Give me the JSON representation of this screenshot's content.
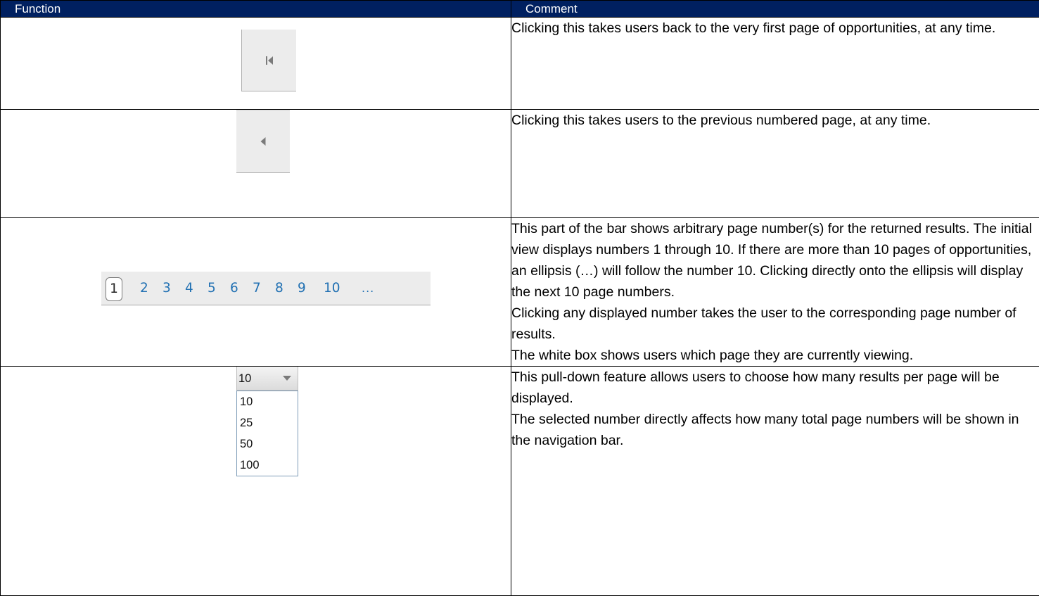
{
  "colors": {
    "header_bg": "#002060",
    "header_text": "#ffffff",
    "link_blue": "#2271b3"
  },
  "table": {
    "headers": {
      "function": "Function",
      "comment": "Comment"
    },
    "rows": [
      {
        "widget": "first-page-button",
        "icon": "first-page-icon",
        "comment": [
          "Clicking this takes users back to the very first page of opportunities, at any time."
        ]
      },
      {
        "widget": "previous-page-button",
        "icon": "previous-page-icon",
        "comment": [
          "Clicking this takes users to the previous numbered page, at any time."
        ]
      },
      {
        "widget": "page-number-bar",
        "comment": [
          "This part of the bar shows arbitrary page number(s) for the returned results. The initial view displays numbers 1 through 10. If there are more than 10 pages of opportunities, an ellipsis (…) will follow the number 10. Clicking directly onto the ellipsis will display the next 10 page numbers.",
          "Clicking any displayed number takes the user to the corresponding page number of results.",
          "The white box shows users which page they are currently viewing."
        ]
      },
      {
        "widget": "results-per-page-dropdown",
        "comment": [
          "This pull-down feature allows users to choose how many results per page will be displayed.",
          "The selected number directly affects how many total page numbers will be shown in the navigation bar."
        ]
      }
    ]
  },
  "pagebar": {
    "current": "1",
    "pages": [
      "2",
      "3",
      "4",
      "5",
      "6",
      "7",
      "8",
      "9",
      "10"
    ],
    "ellipsis": "..."
  },
  "dropdown": {
    "selected": "10",
    "options": [
      "10",
      "25",
      "50",
      "100"
    ]
  }
}
